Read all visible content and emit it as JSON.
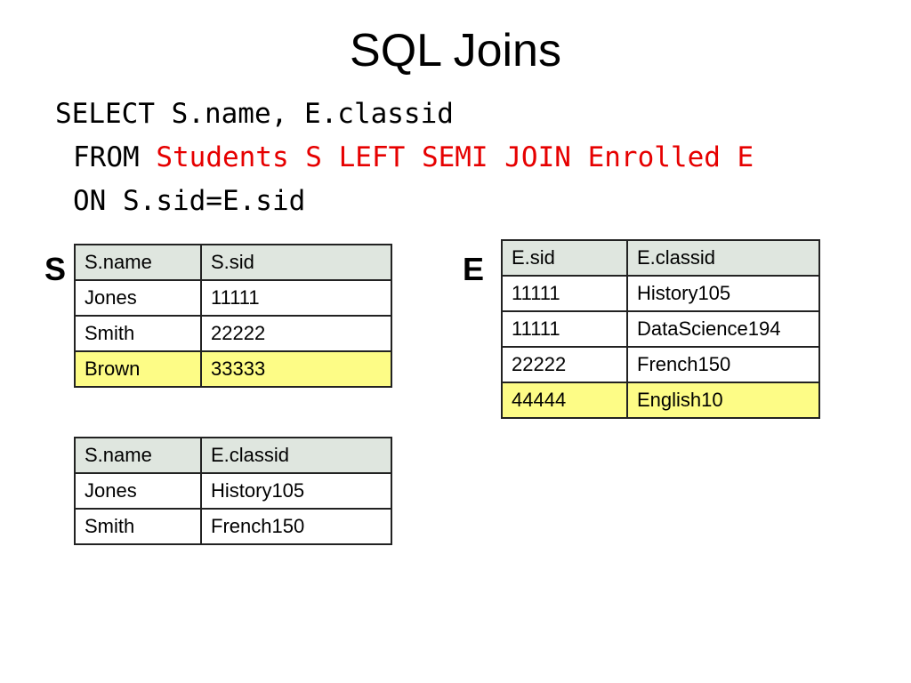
{
  "title": "SQL Joins",
  "query": {
    "line1": "SELECT S.name, E.classid",
    "line2_keyword": "FROM ",
    "line2_highlight": "Students S LEFT SEMI JOIN Enrolled E",
    "line3": "ON S.sid=E.sid"
  },
  "colors": {
    "highlight_text": "#e60000",
    "header_fill": "#dfe6df",
    "row_highlight_fill": "#fdfc86"
  },
  "table_s": {
    "label": "S",
    "headers": [
      "S.name",
      "S.sid"
    ],
    "rows": [
      [
        "Jones",
        "11111"
      ],
      [
        "Smith",
        "22222"
      ],
      [
        "Brown",
        "33333"
      ]
    ],
    "highlighted_row": 2
  },
  "table_e": {
    "label": "E",
    "headers": [
      "E.sid",
      "E.classid"
    ],
    "rows": [
      [
        "11111",
        "History105"
      ],
      [
        "11111",
        "DataScience194"
      ],
      [
        "22222",
        "French150"
      ],
      [
        "44444",
        "English10"
      ]
    ],
    "highlighted_row": 3
  },
  "table_result": {
    "headers": [
      "S.name",
      "E.classid"
    ],
    "rows": [
      [
        "Jones",
        "History105"
      ],
      [
        "Smith",
        "French150"
      ]
    ]
  }
}
